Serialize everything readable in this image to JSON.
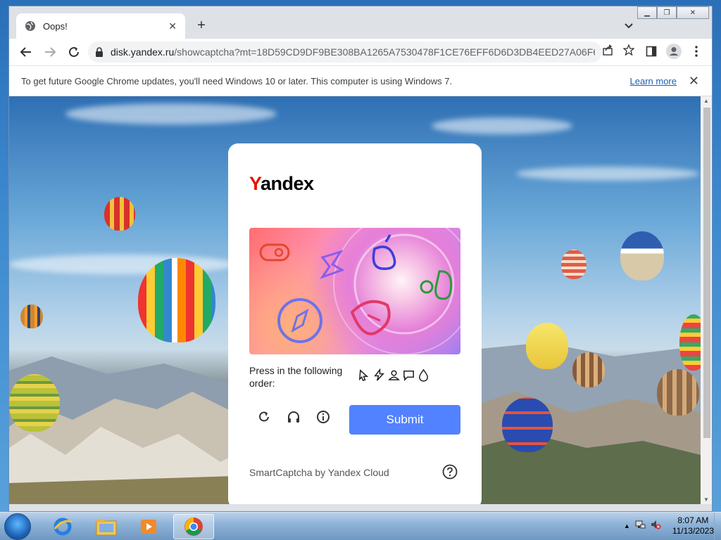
{
  "browser": {
    "tab_title": "Oops!",
    "new_tab": "+",
    "tab_close": "✕",
    "url_host": "disk.yandex.ru",
    "url_path": "/showcaptcha?mt=18D59CD9DF9BE308BA1265A7530478F1CE76EFF6D6D3DB4EED27A06F67...",
    "infobar_message": "To get future Google Chrome updates, you'll need Windows 10 or later. This computer is using Windows 7.",
    "infobar_link": "Learn more",
    "infobar_close": "✕"
  },
  "captcha": {
    "brand_first": "Y",
    "brand_rest": "andex",
    "instruction": "Press in the following order:",
    "order_icon_names": [
      "cursor-icon",
      "bolt-icon",
      "user-icon",
      "chat-icon",
      "drop-icon"
    ],
    "submit_label": "Submit",
    "footer": "SmartCaptcha by Yandex Cloud",
    "help": "?"
  },
  "taskbar": {
    "apps": [
      "windows-explorer",
      "internet-explorer",
      "file-explorer",
      "media-player",
      "chrome"
    ],
    "time": "8:07 AM",
    "date": "11/13/2023"
  },
  "colors": {
    "brand_red": "#e61400",
    "submit_blue": "#5282ff",
    "link_blue": "#1a5fb4"
  }
}
